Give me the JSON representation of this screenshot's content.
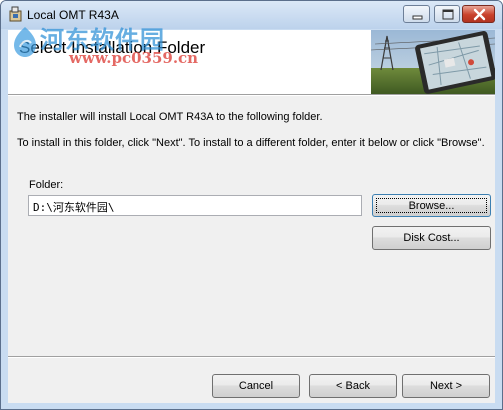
{
  "window": {
    "title": "Local OMT R43A",
    "controls": {
      "minimize": "minimize",
      "maximize": "maximize",
      "close": "close"
    }
  },
  "banner": {
    "title": "Select Installation Folder"
  },
  "watermark": {
    "site_name": "河东软件园",
    "url": "www.pc0359.cn"
  },
  "body": {
    "line1": "The installer will install Local OMT R43A to the following folder.",
    "line2": "To install in this folder, click \"Next\". To install to a different folder, enter it below or click \"Browse\"."
  },
  "folder": {
    "label": "Folder:",
    "value": "D:\\河东软件园\\"
  },
  "buttons": {
    "browse": "Browse...",
    "disk_cost": "Disk Cost...",
    "cancel": "Cancel",
    "back": "< Back",
    "next": "Next >"
  },
  "icons": {
    "app": "installer-box-icon",
    "banner": "tablet-map-image"
  }
}
